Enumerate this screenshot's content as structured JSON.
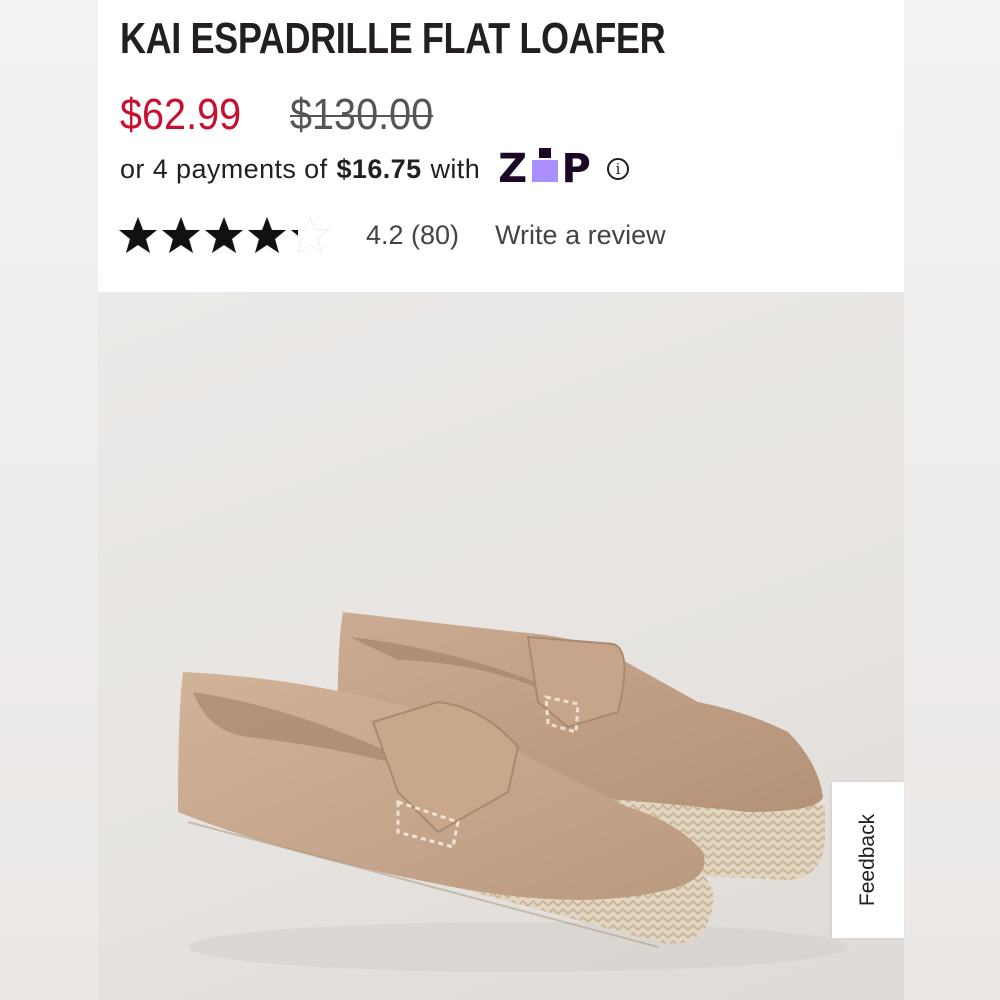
{
  "product": {
    "title": "KAI ESPADRILLE FLAT LOAFER",
    "sale_price": "$62.99",
    "original_price": "$130.00"
  },
  "payments": {
    "prefix": "or 4 payments of",
    "amount": "$16.75",
    "suffix": "with",
    "provider_logo_text": "zip",
    "info_icon": "info-icon"
  },
  "rating": {
    "stars": 4.2,
    "max_stars": 5,
    "summary": "4.2 (80)",
    "write_review_label": "Write a review"
  },
  "image": {
    "description_icon": "product-photo"
  },
  "feedback": {
    "label": "Feedback"
  },
  "colors": {
    "sale_price": "#c8102e",
    "zip_dark": "#1a0826",
    "zip_purple": "#aa8fff",
    "suede": "#c8a88c"
  }
}
